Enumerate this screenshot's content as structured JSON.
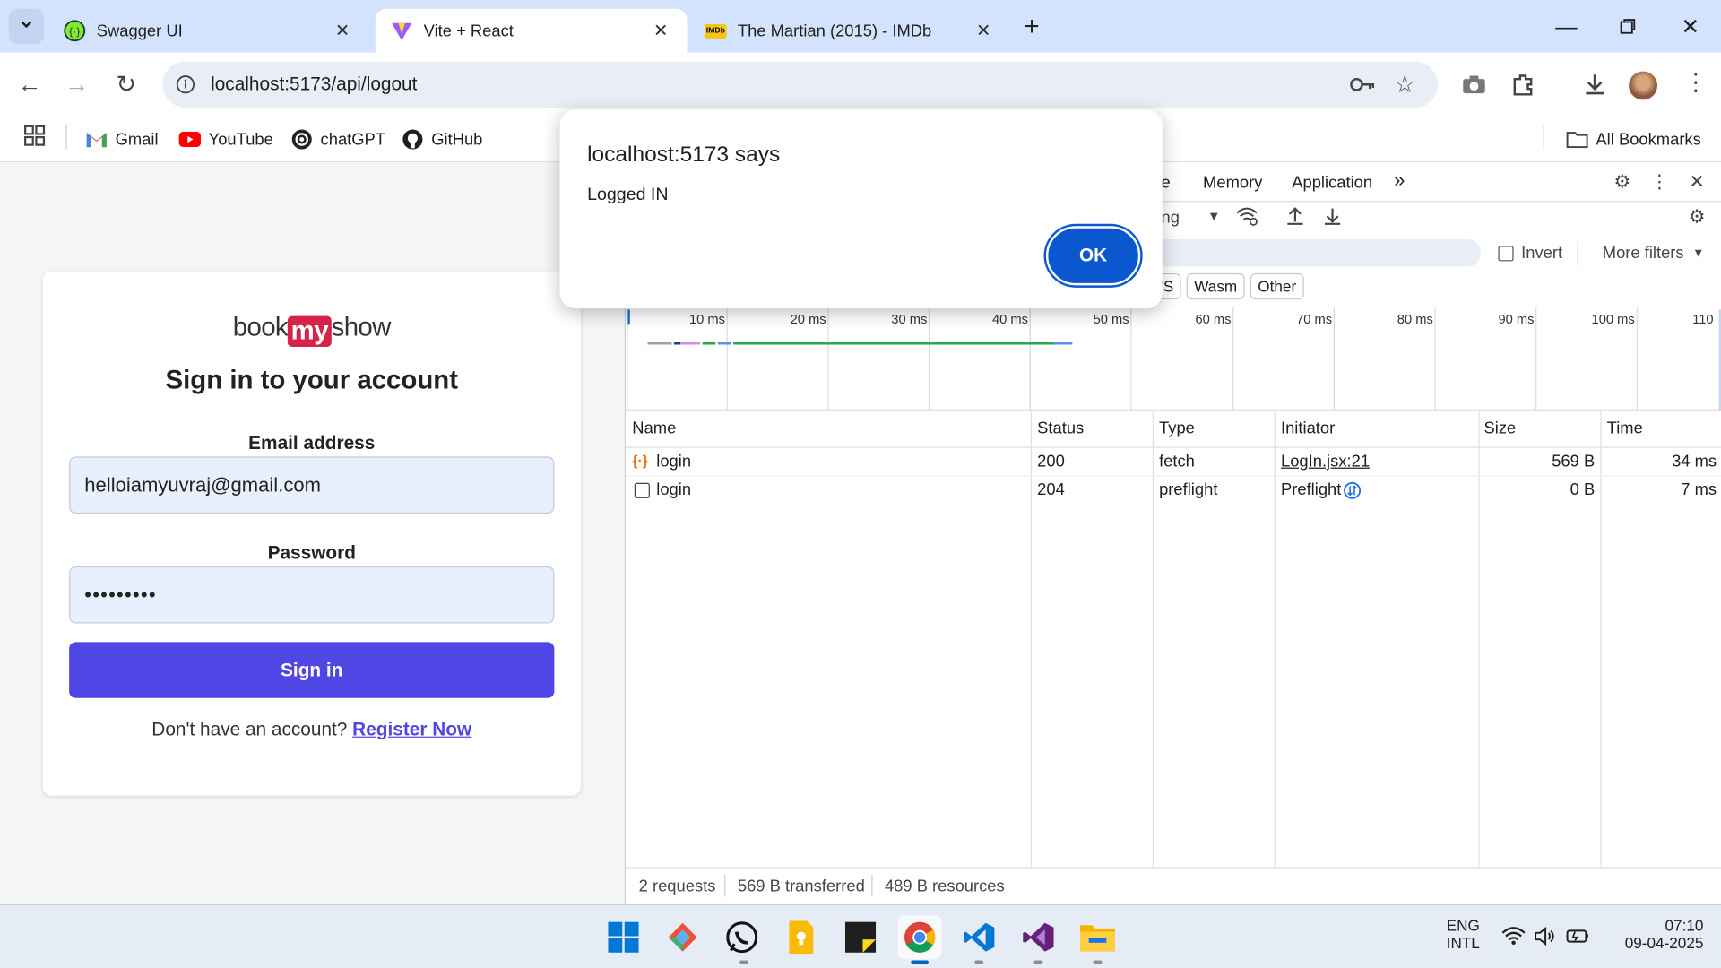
{
  "browser": {
    "tabs": [
      {
        "title": "Swagger UI",
        "icon": "swagger-icon",
        "active": false
      },
      {
        "title": "Vite + React",
        "icon": "vite-icon",
        "active": true
      },
      {
        "title": "The Martian (2015) - IMDb",
        "icon": "imdb-icon",
        "active": false
      }
    ],
    "url": "localhost:5173/api/logout",
    "bookmarks": [
      {
        "label": "Gmail",
        "icon": "gmail-icon"
      },
      {
        "label": "YouTube",
        "icon": "youtube-icon"
      },
      {
        "label": "chatGPT",
        "icon": "chatgpt-icon"
      },
      {
        "label": "GitHub",
        "icon": "github-icon"
      }
    ],
    "all_bookmarks": "All Bookmarks",
    "imdb_badge": "IMDb"
  },
  "login": {
    "logo_book": "book",
    "logo_my": "my",
    "logo_show": "show",
    "heading": "Sign in to your account",
    "email_label": "Email address",
    "email_value": "helloiamyuvraj@gmail.com",
    "password_label": "Password",
    "password_value": "•••••••••",
    "submit": "Sign in",
    "footer_text": "Don't have an account?",
    "register_link": "Register Now"
  },
  "devtools": {
    "tabs": [
      "e",
      "Memory",
      "Application"
    ],
    "throttle_partial": "ng",
    "invert_label": "Invert",
    "more_filters": "More filters",
    "filter_chips": [
      "/S",
      "Wasm",
      "Other"
    ],
    "ticks": [
      "10 ms",
      "20 ms",
      "30 ms",
      "40 ms",
      "50 ms",
      "60 ms",
      "70 ms",
      "80 ms",
      "90 ms",
      "100 ms",
      "110"
    ],
    "columns": [
      "Name",
      "Status",
      "Type",
      "Initiator",
      "Size",
      "Time"
    ],
    "rows": [
      {
        "name": "login",
        "status": "200",
        "type": "fetch",
        "initiator": "LogIn.jsx:21",
        "size": "569 B",
        "time": "34 ms"
      },
      {
        "name": "login",
        "status": "204",
        "type": "preflight",
        "initiator": "Preflight",
        "size": "0 B",
        "time": "7 ms"
      }
    ],
    "summary": [
      "2 requests",
      "569 B transferred",
      "489 B resources"
    ]
  },
  "dialog": {
    "title": "localhost:5173 says",
    "message": "Logged IN",
    "ok": "OK"
  },
  "taskbar": {
    "lang1": "ENG",
    "lang2": "INTL",
    "time": "07:10",
    "date": "09-04-2025"
  },
  "colors": {
    "accent": "#4f46e5",
    "chrome_tabstrip": "#d3e3fd",
    "dialog_ok": "#0b57d0"
  }
}
